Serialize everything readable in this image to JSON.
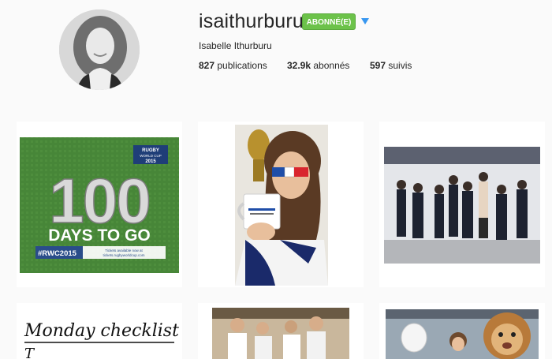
{
  "profile": {
    "username": "isaithurburu",
    "follow_button": "ABONNÉ(E)",
    "full_name": "Isabelle Ithurburu",
    "stats": {
      "publications_count": "827",
      "publications_label": "publications",
      "followers_count": "32.9k",
      "followers_label": "abonnés",
      "following_count": "597",
      "following_label": "suivis"
    }
  },
  "posts": {
    "p1": {
      "badge_top": "RUGBY",
      "badge_bottom": "WORLD CUP",
      "badge_year": "2015",
      "big_number": "100",
      "headline": "DAYS TO GO",
      "hashtag": "#RWC2015",
      "tickets_line1": "Tickets available now at",
      "tickets_line2": "tickets.rugbyworldcup.com"
    },
    "p7": {
      "title": "Monday checklist"
    }
  },
  "colors": {
    "follow_green": "#6cc24a",
    "dropdown_blue": "#3897f0",
    "background": "#fafafa"
  },
  "icons": {
    "dropdown": "triangle-down-icon"
  }
}
